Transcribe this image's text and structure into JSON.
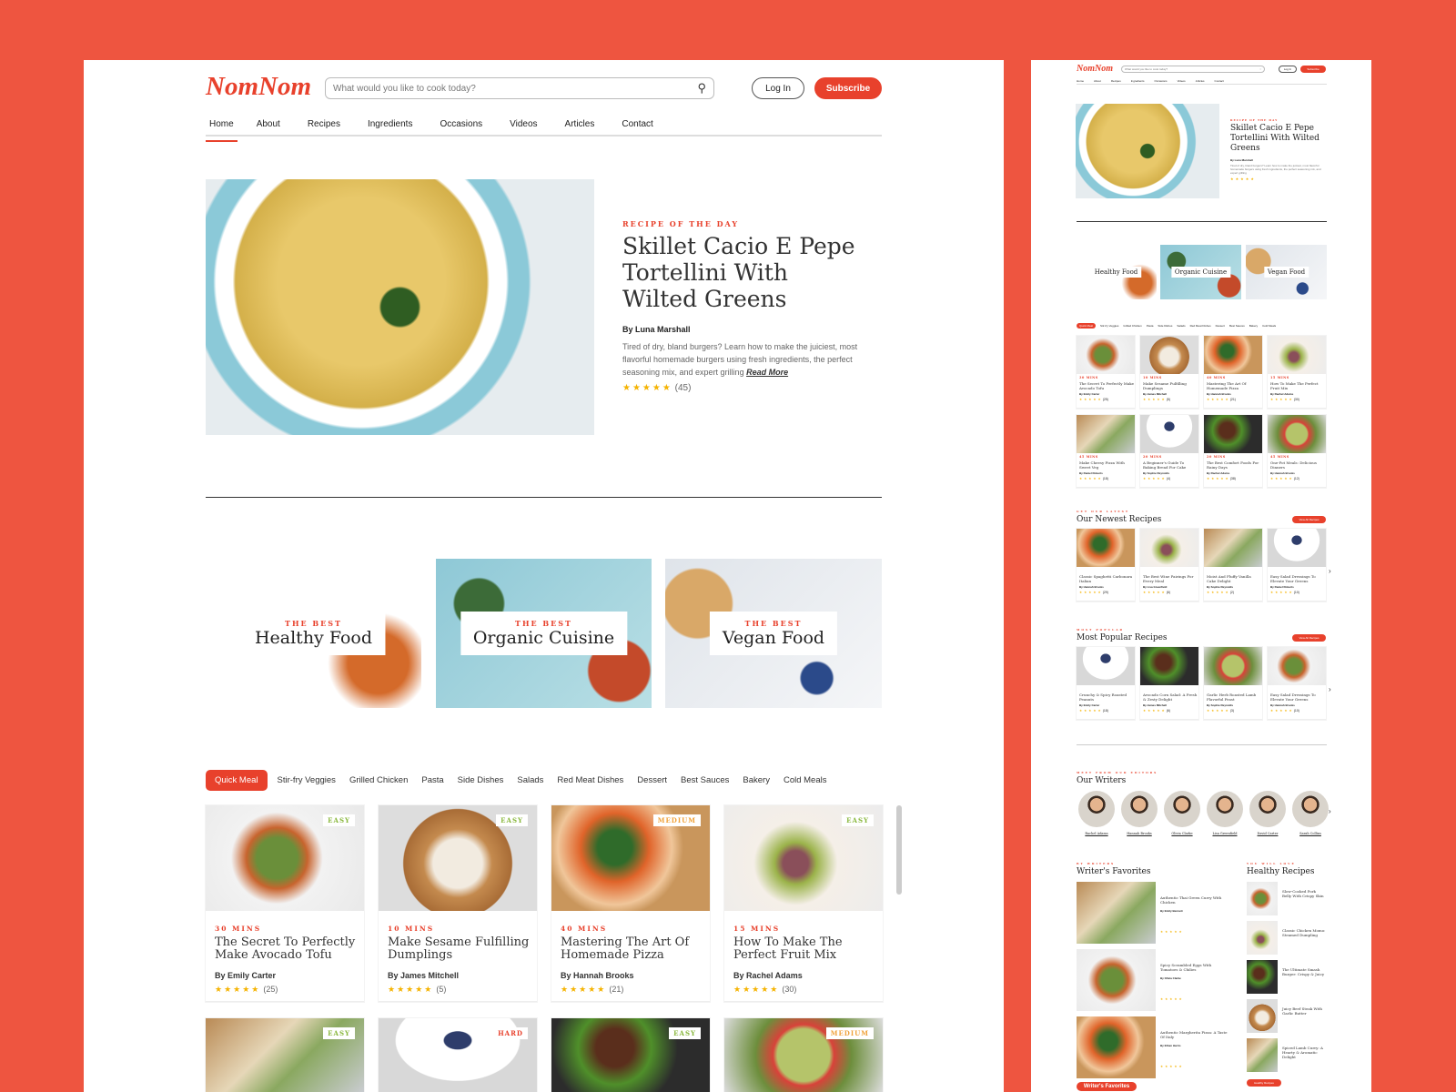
{
  "brand": {
    "logo": "NomNom",
    "accent": "#e8412c",
    "background": "#ee5540"
  },
  "header": {
    "search_placeholder": "What would you like to cook today?",
    "login": "Log In",
    "subscribe": "Subscribe"
  },
  "nav": [
    {
      "label": "Home",
      "active": true
    },
    {
      "label": "About"
    },
    {
      "label": "Recipes"
    },
    {
      "label": "Ingredients"
    },
    {
      "label": "Occasions"
    },
    {
      "label": "Videos"
    },
    {
      "label": "Articles"
    },
    {
      "label": "Contact"
    }
  ],
  "hero": {
    "kicker": "RECIPE OF THE DAY",
    "title": "Skillet Cacio E Pepe Tortellini With Wilted Greens",
    "author": "By Luna Marshall",
    "description": "Tired of dry, bland burgers? Learn how to make the juiciest, most flavorful homemade burgers using fresh ingredients, the perfect seasoning mix, and expert grilling",
    "read_more": "Read More",
    "rating": 5,
    "reviews": "(45)"
  },
  "categories": [
    {
      "kicker": "THE BEST",
      "label": "Healthy Food"
    },
    {
      "kicker": "THE BEST",
      "label": "Organic Cuisine"
    },
    {
      "kicker": "THE BEST",
      "label": "Vegan Food"
    }
  ],
  "filter_tabs": [
    "Quick Meal",
    "Stir-fry Veggies",
    "Grilled Chicken",
    "Pasta",
    "Side Dishes",
    "Salads",
    "Red Meat Dishes",
    "Dessert",
    "Best Sauces",
    "Bakery",
    "Cold Meals"
  ],
  "recipes": [
    {
      "badge": "EASY",
      "mins": "30 MINS",
      "title": "The Secret To Perfectly Make Avocado Tofu",
      "author": "By Emily Carter",
      "reviews": "(25)"
    },
    {
      "badge": "EASY",
      "mins": "10 MINS",
      "title": "Make Sesame Fulfilling Dumplings",
      "author": "By James Mitchell",
      "reviews": "(5)"
    },
    {
      "badge": "MEDIUM",
      "mins": "40 MINS",
      "title": "Mastering The Art Of Homemade Pizza",
      "author": "By Hannah Brooks",
      "reviews": "(21)"
    },
    {
      "badge": "EASY",
      "mins": "15 MINS",
      "title": "How To Make The Perfect Fruit Mix",
      "author": "By Rachel Adams",
      "reviews": "(30)"
    },
    {
      "badge": "EASY",
      "mins": "45 MINS",
      "title": "Make Cheesy Pizza With Sweet Veg",
      "author": "By Daniel Roberts",
      "reviews": "(18)"
    },
    {
      "badge": "HARD",
      "mins": "20 MINS",
      "title": "A Beginner's Guide To Baking Bread For Cake",
      "author": "By Sophie Reynolds",
      "reviews": "(4)"
    },
    {
      "badge": "EASY",
      "mins": "20 MINS",
      "title": "The Best Comfort Foods For Rainy Days",
      "author": "By Rachel Adams",
      "reviews": "(38)"
    },
    {
      "badge": "MEDIUM",
      "mins": "45 MINS",
      "title": "One-Pot Meals: Delicious Dinners",
      "author": "By Hannah Brooks",
      "reviews": "(12)"
    }
  ],
  "newest": {
    "kicker": "GET OUR LATEST",
    "title": "Our Newest Recipes",
    "button": "View All Recipes",
    "items": [
      {
        "title": "Classic Spaghetti Carbonara Italian",
        "author": "By Hannah Brooks",
        "reviews": "(29)"
      },
      {
        "title": "The Best Wine Pairings For Every Meal",
        "author": "By Lisa Greenfield",
        "reviews": "(6)"
      },
      {
        "title": "Moist And Fluffy Vanilla Cake Delight",
        "author": "By Sophie Reynolds",
        "reviews": "(2)"
      },
      {
        "title": "Easy Salad Dressings To Elevate Your Greens",
        "author": "By Daniel Roberts",
        "reviews": "(10)"
      }
    ]
  },
  "popular": {
    "kicker": "MOST POPULAR",
    "title": "Most Popular Recipes",
    "button": "View All Recipes",
    "items": [
      {
        "title": "Crunchy & Spicy Roasted Peanuts",
        "author": "By Emily Carter",
        "reviews": "(18)"
      },
      {
        "title": "Avocado Corn Salad: A Fresh & Zesty Delight",
        "author": "By James Mitchell",
        "reviews": "(6)"
      },
      {
        "title": "Garlic Herb Roasted Lamb Flavorful Feast",
        "author": "By Sophie Reynolds",
        "reviews": "(3)"
      },
      {
        "title": "Easy Salad Dressings To Elevate Your Greens",
        "author": "By Hannah Brooks",
        "reviews": "(10)"
      }
    ]
  },
  "writers": {
    "kicker": "MEET FROM OUR EDITORS",
    "title": "Our Writers",
    "names": [
      "Rachel Adams",
      "Hannah Brooks",
      "Olivia Clarke",
      "Lisa Greenfield",
      "David Carter",
      "Sarah Collins"
    ]
  },
  "favorites": {
    "kicker": "BY WRITERS",
    "title": "Writer's Favorites",
    "button": "Writer's Favorites",
    "items": [
      {
        "title": "Authentic Thai Green Curry With Chicken",
        "author": "By Emily Bennett"
      },
      {
        "title": "Spicy Scrambled Eggs With Tomatoes & Chilies",
        "author": "By Olivia Clarke"
      },
      {
        "title": "Authentic Margherita Pizza: A Taste Of Italy",
        "author": "By Ethan Harris"
      }
    ]
  },
  "healthy": {
    "kicker": "YOU WILL LOVE",
    "title": "Healthy Recipes",
    "button": "Healthy Recipes",
    "items": [
      "Slow-Cooked Pork Belly With Crispy Skin",
      "Classic Chicken Momo: Steamed Dumpling",
      "The Ultimate Smash Burger: Crispy & Juicy",
      "Juicy Beef Steak With Garlic Butter",
      "Spiced Lamb Curry: A Hearty & Aromatic Delight"
    ]
  }
}
